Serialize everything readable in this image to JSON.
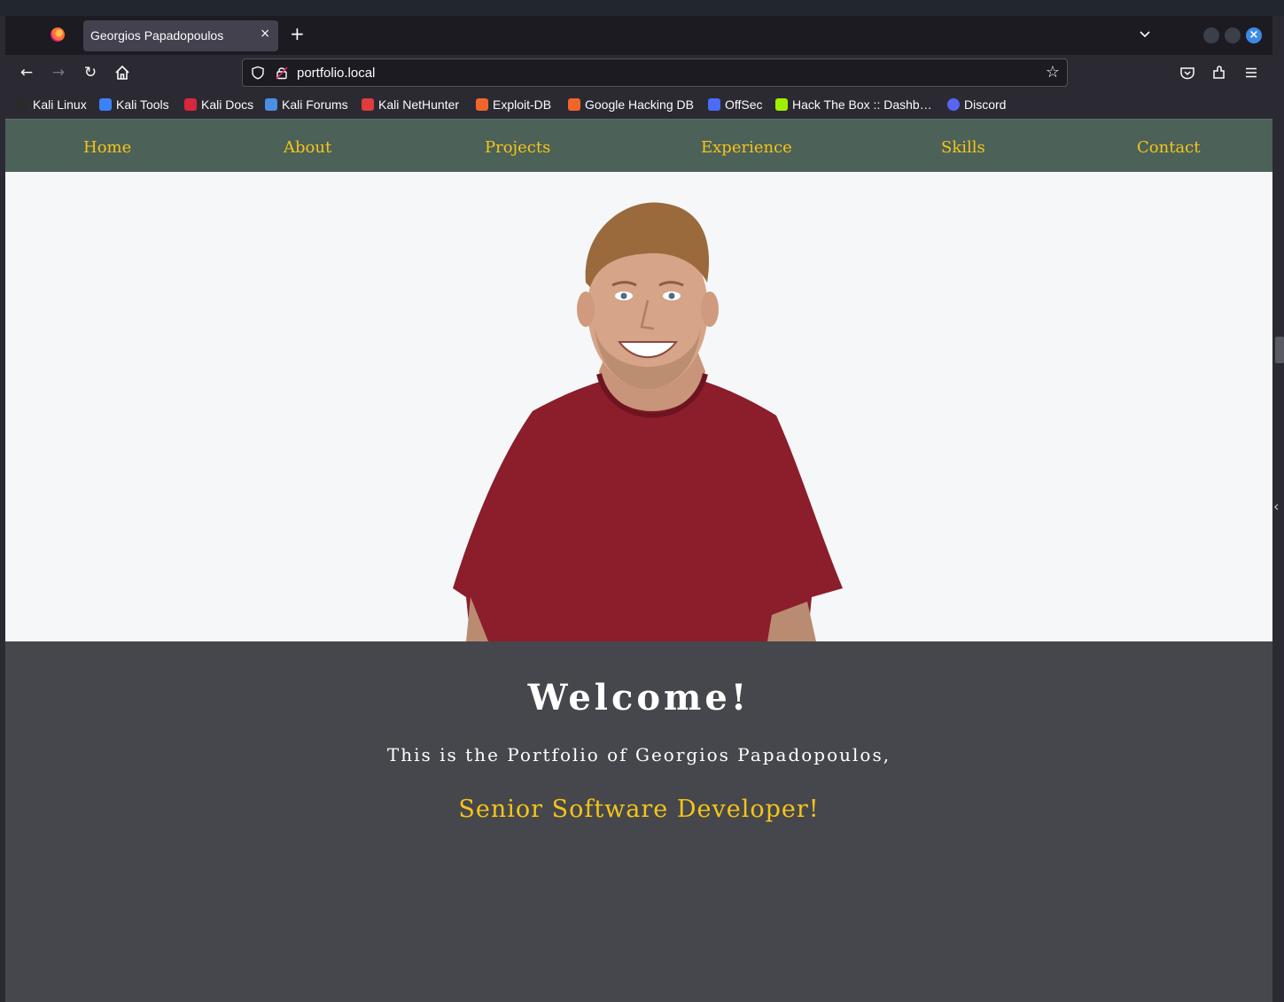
{
  "browser": {
    "tab_title": "Georgios Papadopoulos",
    "tab_close": "×",
    "new_tab": "+",
    "url": "portfolio.local",
    "star": "☆"
  },
  "bookmarks": [
    {
      "label": "Kali Linux",
      "icon": "kali-dragon-icon",
      "color": "#2a2a2a"
    },
    {
      "label": "Kali Tools",
      "icon": "kali-tools-icon",
      "color": "#3b82f6"
    },
    {
      "label": "Kali Docs",
      "icon": "kali-docs-icon",
      "color": "#d7263d"
    },
    {
      "label": "Kali Forums",
      "icon": "kali-forums-icon",
      "color": "#4a90e2"
    },
    {
      "label": "Kali NetHunter",
      "icon": "nethunter-icon",
      "color": "#e23b3b"
    },
    {
      "label": "Exploit-DB",
      "icon": "exploit-db-icon",
      "color": "#f0662a"
    },
    {
      "label": "Google Hacking DB",
      "icon": "ghdb-icon",
      "color": "#f0662a"
    },
    {
      "label": "OffSec",
      "icon": "offsec-icon",
      "color": "#4a6cf7"
    },
    {
      "label": "Hack The Box :: Dashb…",
      "icon": "htb-icon",
      "color": "#9fef00"
    },
    {
      "label": "Discord",
      "icon": "discord-icon",
      "color": "#5865f2"
    }
  ],
  "site": {
    "nav": [
      "Home",
      "About",
      "Projects",
      "Experience",
      "Skills",
      "Contact"
    ],
    "welcome": "Welcome!",
    "intro": "This is the Portfolio of Georgios Papadopoulos,",
    "role": "Senior Software Developer!",
    "colors": {
      "nav_bg": "#4c6158",
      "accent": "#f5c518",
      "page_bg": "#46474c",
      "hero_bg": "#f5f7f8",
      "shirt": "#8c1d2b"
    }
  }
}
